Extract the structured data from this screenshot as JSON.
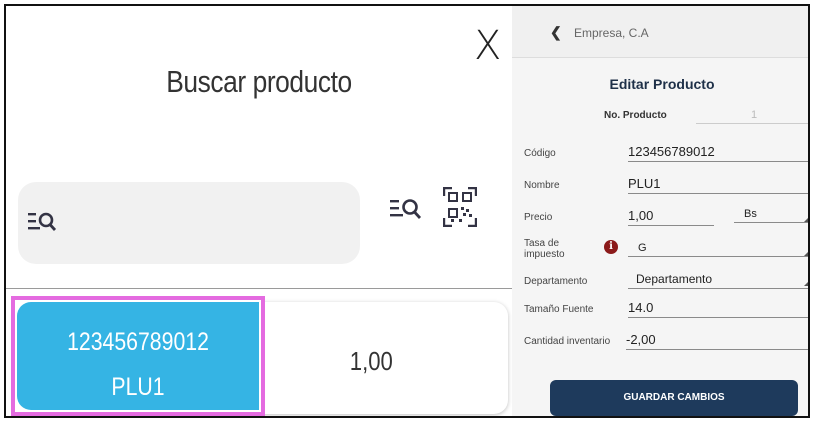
{
  "left_panel": {
    "title": "Buscar producto",
    "close_symbol": "X",
    "search": {
      "value": "",
      "placeholder": ""
    },
    "icons": {
      "search": "search-list-icon",
      "filter": "filter-search-icon",
      "qr": "qr-scan-icon"
    },
    "product": {
      "code": "123456789012",
      "name": "PLU1",
      "price": "1,00"
    },
    "colors": {
      "card": "#35b4e4",
      "highlight": "#e46be0"
    }
  },
  "right_panel": {
    "company": "Empresa, C.A",
    "title": "Editar Producto",
    "no_producto_label": "No. Producto",
    "no_producto_value": "1",
    "fields": {
      "codigo_label": "Código",
      "codigo_value": "123456789012",
      "nombre_label": "Nombre",
      "nombre_value": "PLU1",
      "precio_label": "Precio",
      "precio_value": "1,00",
      "moneda_value": "Bs",
      "tasa_label_1": "Tasa de",
      "tasa_label_2": "impuesto",
      "tasa_value": "G",
      "departamento_label": "Departamento",
      "departamento_value": "Departamento",
      "tamano_label": "Tamaño Fuente",
      "tamano_value": "14.0",
      "cantidad_label": "Cantidad inventario",
      "cantidad_value": "-2,00"
    },
    "save_label": "GUARDAR CAMBIOS",
    "colors": {
      "button": "#1e3a5c",
      "info": "#8b1a1a"
    }
  }
}
